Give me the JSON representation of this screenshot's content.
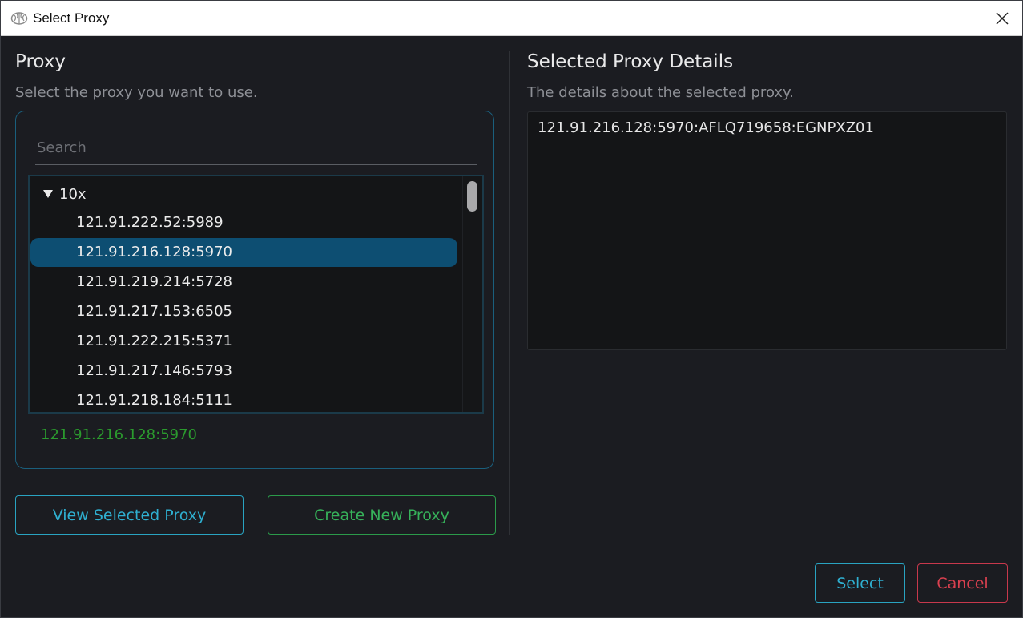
{
  "window": {
    "title": "Select Proxy"
  },
  "left": {
    "heading": "Proxy",
    "subheading": "Select the proxy you want to use.",
    "search": {
      "placeholder": "Search",
      "value": ""
    },
    "tree": {
      "group_label": "10x",
      "items": [
        {
          "label": "121.91.222.52:5989",
          "selected": false
        },
        {
          "label": "121.91.216.128:5970",
          "selected": true
        },
        {
          "label": "121.91.219.214:5728",
          "selected": false
        },
        {
          "label": "121.91.217.153:6505",
          "selected": false
        },
        {
          "label": "121.91.222.215:5371",
          "selected": false
        },
        {
          "label": "121.91.217.146:5793",
          "selected": false
        },
        {
          "label": "121.91.218.184:5111",
          "selected": false
        }
      ]
    },
    "selected_proxy": "121.91.216.128:5970",
    "buttons": {
      "view": "View Selected Proxy",
      "create": "Create New Proxy"
    }
  },
  "right": {
    "heading": "Selected Proxy Details",
    "subheading": "The details about the selected proxy.",
    "details": "121.91.216.128:5970:AFLQ719658:EGNPXZ01"
  },
  "footer": {
    "select": "Select",
    "cancel": "Cancel"
  },
  "colors": {
    "background": "#1b1c21",
    "accent_blue": "#2fb0d1",
    "accent_green": "#36b25a",
    "accent_red": "#d9404f",
    "selection": "#0d4e72",
    "selected_text": "#2b9a2e"
  },
  "icons": {
    "app": "brain-icon",
    "close": "close-icon",
    "group_toggle": "triangle-down-icon"
  }
}
